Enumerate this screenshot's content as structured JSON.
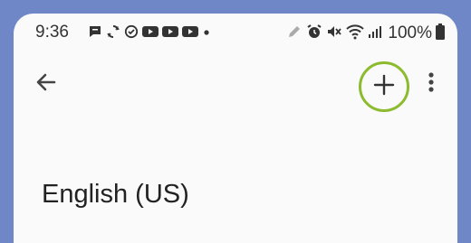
{
  "status_bar": {
    "time": "9:36",
    "notification_icons": [
      "chat-icon",
      "sync-icon",
      "check-circle-icon",
      "youtube-icon",
      "youtube-icon",
      "youtube-icon",
      "dot-icon"
    ],
    "system_icons": [
      "pen-icon",
      "alarm-icon",
      "mute-icon",
      "wifi-icon",
      "signal-icon"
    ],
    "battery_text": "100%"
  },
  "app_bar": {
    "back_icon": "arrow-back-icon",
    "add_icon": "plus-icon",
    "add_highlight_color": "#8dbb2e",
    "more_icon": "more-vert-icon"
  },
  "languages": [
    {
      "label": "English (US)"
    }
  ],
  "colors": {
    "frame": "#6f87c6",
    "screen": "#fafafa",
    "text": "#222222"
  }
}
